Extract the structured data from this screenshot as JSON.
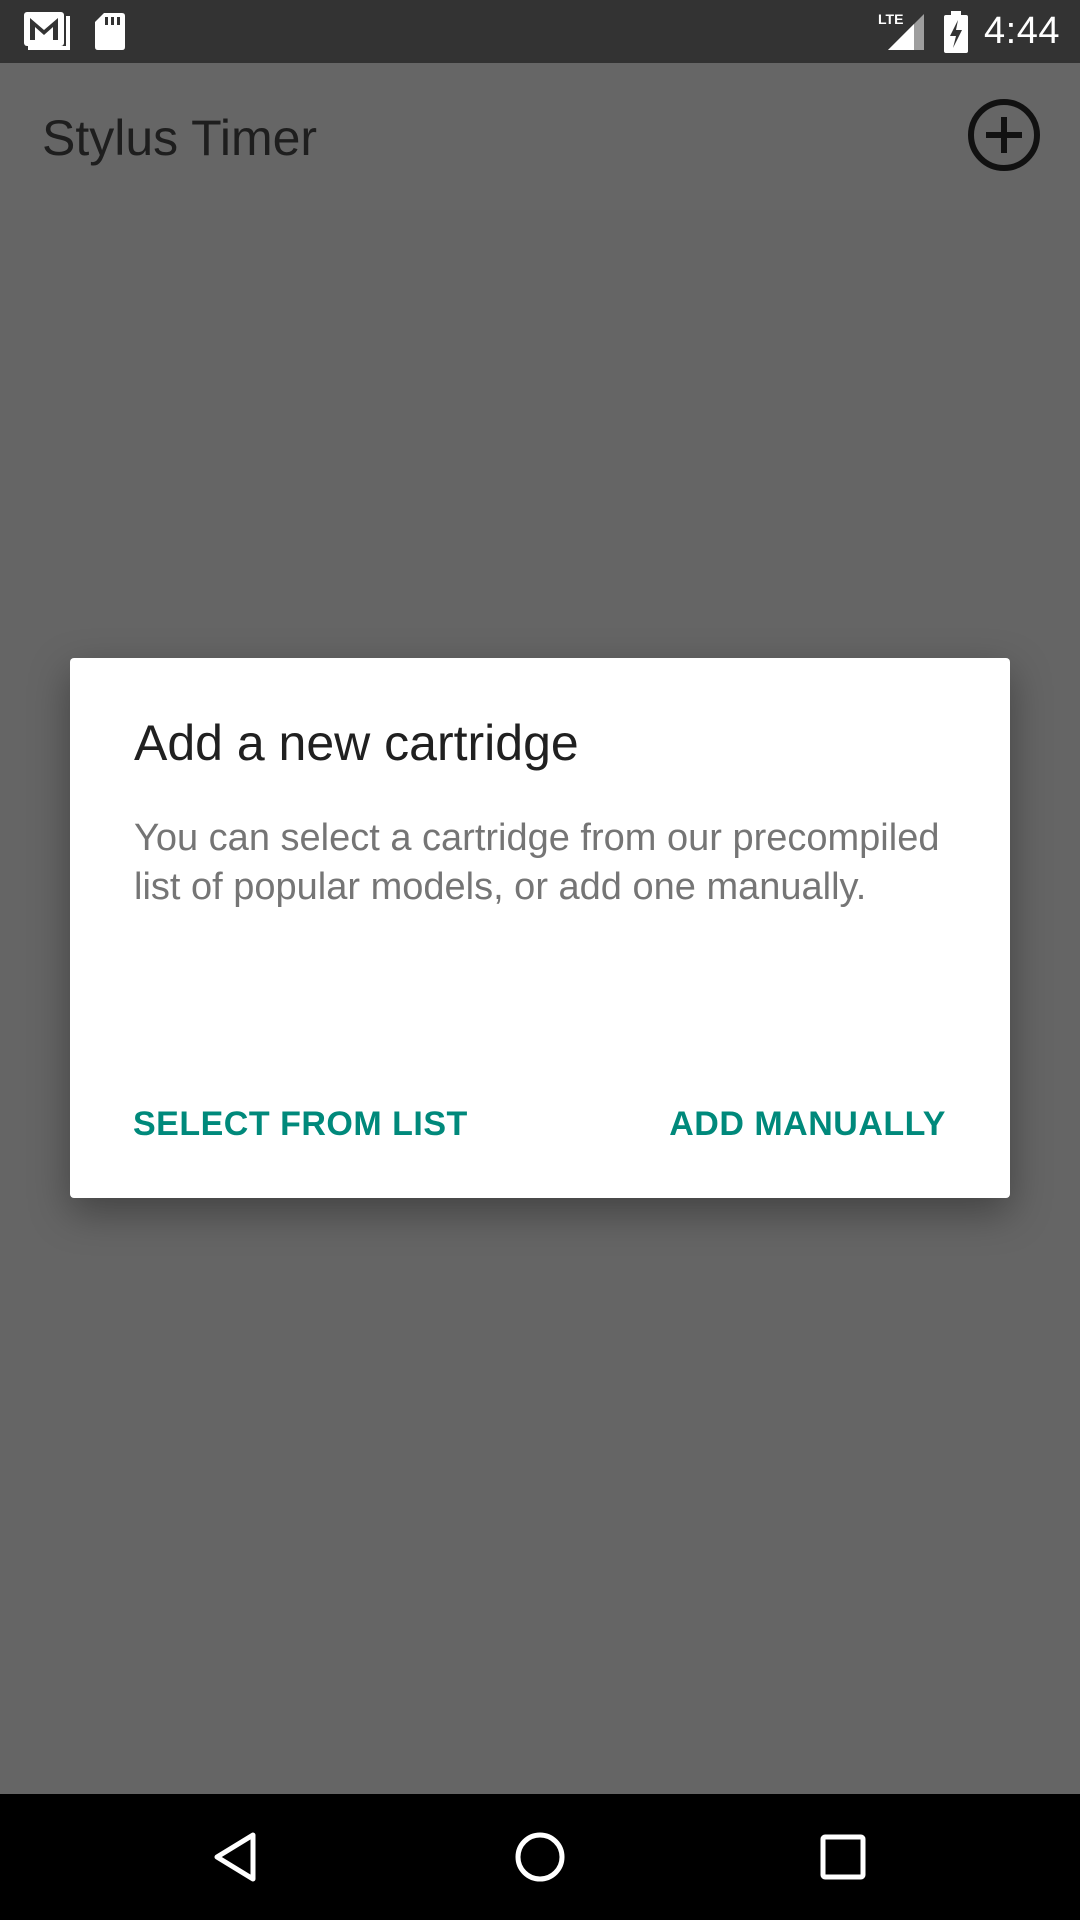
{
  "status_bar": {
    "time": "4:44",
    "network": "LTE",
    "icons": [
      "gmail-icon",
      "sd-card-icon",
      "signal-icon",
      "battery-charging-icon"
    ]
  },
  "app_bar": {
    "title": "Stylus Timer",
    "action_icon": "add-circle-icon"
  },
  "dialog": {
    "title": "Add a new cartridge",
    "message": "You can select a cartridge from our precompiled list of popular models, or add one manually.",
    "buttons": {
      "select_label": "SELECT FROM LIST",
      "manual_label": "ADD MANUALLY"
    },
    "accent_color": "#00897b"
  },
  "nav_bar": {
    "icons": [
      "back-icon",
      "home-icon",
      "recents-icon"
    ]
  }
}
